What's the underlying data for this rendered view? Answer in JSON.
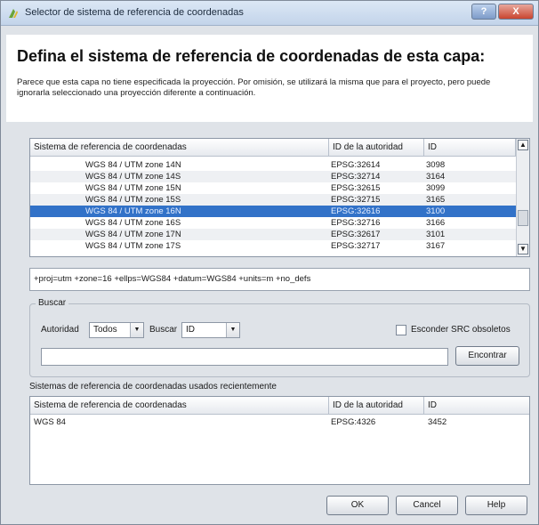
{
  "window": {
    "title": "Selector de sistema de referencia de coordenadas",
    "help_button": "?",
    "close_button": "X"
  },
  "header": {
    "title": "Defina el sistema de referencia de coordenadas de esta capa:",
    "description": "Parece que esta capa no tiene especificada la proyección. Por omisión, se utilizará la misma que para el proyecto, pero puede ignorarla seleccionado una proyección diferente a continuación."
  },
  "crs_table": {
    "columns": [
      "Sistema de referencia de coordenadas",
      "ID de la autoridad",
      "ID"
    ],
    "rows": [
      {
        "name": "WGS 84 / UTM zone 14N",
        "authority": "EPSG:32614",
        "id": "3098"
      },
      {
        "name": "WGS 84 / UTM zone 14S",
        "authority": "EPSG:32714",
        "id": "3164"
      },
      {
        "name": "WGS 84 / UTM zone 15N",
        "authority": "EPSG:32615",
        "id": "3099"
      },
      {
        "name": "WGS 84 / UTM zone 15S",
        "authority": "EPSG:32715",
        "id": "3165"
      },
      {
        "name": "WGS 84 / UTM zone 16N",
        "authority": "EPSG:32616",
        "id": "3100"
      },
      {
        "name": "WGS 84 / UTM zone 16S",
        "authority": "EPSG:32716",
        "id": "3166"
      },
      {
        "name": "WGS 84 / UTM zone 17N",
        "authority": "EPSG:32617",
        "id": "3101"
      },
      {
        "name": "WGS 84 / UTM zone 17S",
        "authority": "EPSG:32717",
        "id": "3167"
      }
    ],
    "selected_index": 4
  },
  "proj_string": "+proj=utm +zone=16 +ellps=WGS84 +datum=WGS84 +units=m +no_defs",
  "search": {
    "group_label": "Buscar",
    "authority_label": "Autoridad",
    "authority_value": "Todos",
    "search_label": "Buscar",
    "search_value": "ID",
    "hide_obsolete_label": "Esconder SRC obsoletos",
    "search_text": "",
    "find_button": "Encontrar"
  },
  "recent": {
    "label": "Sistemas de referencia de coordenadas usados recientemente",
    "columns": [
      "Sistema de referencia de coordenadas",
      "ID de la autoridad",
      "ID"
    ],
    "rows": [
      {
        "name": "WGS 84",
        "authority": "EPSG:4326",
        "id": "3452"
      }
    ]
  },
  "buttons": {
    "ok": "OK",
    "cancel": "Cancel",
    "help": "Help"
  },
  "scroll_up": "▲",
  "scroll_down": "▼",
  "combo_arrow": "▼",
  "colors": {
    "selection": "#3272c8",
    "dialog_bg": "#dfe3e8"
  }
}
